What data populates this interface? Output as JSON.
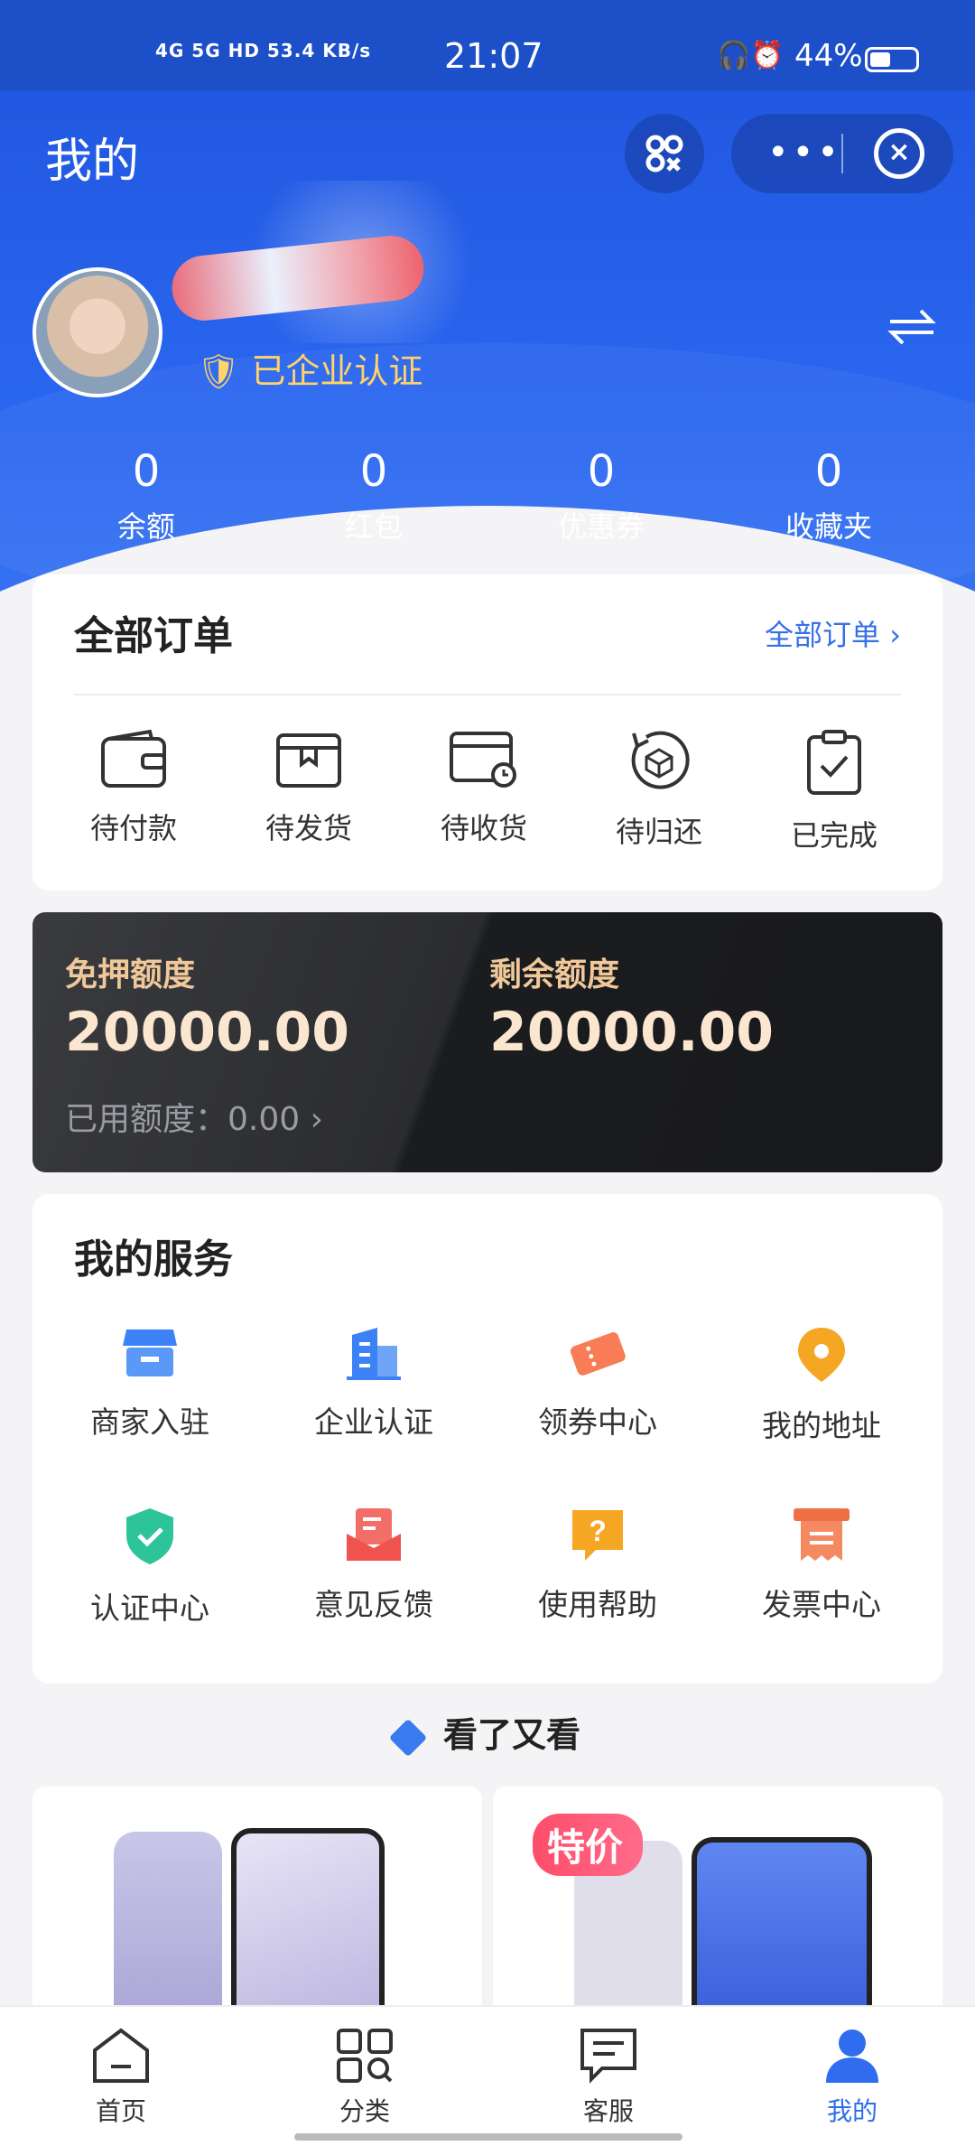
{
  "status_bar": {
    "network": "4G 5G HD 53.4 KB/s",
    "time": "21:07",
    "battery": "44%"
  },
  "header": {
    "title": "我的"
  },
  "profile": {
    "cert_label": "已企业认证"
  },
  "stats": [
    {
      "value": "0",
      "label": "余额"
    },
    {
      "value": "0",
      "label": "红包"
    },
    {
      "value": "0",
      "label": "优惠券"
    },
    {
      "value": "0",
      "label": "收藏夹"
    }
  ],
  "orders": {
    "title": "全部订单",
    "link": "全部订单",
    "items": [
      {
        "label": "待付款",
        "icon": "wallet-icon"
      },
      {
        "label": "待发货",
        "icon": "package-icon"
      },
      {
        "label": "待收货",
        "icon": "receive-icon"
      },
      {
        "label": "待归还",
        "icon": "return-icon"
      },
      {
        "label": "已完成",
        "icon": "clipboard-check-icon"
      }
    ]
  },
  "credit": {
    "deposit_free_label": "免押额度",
    "deposit_free_value": "20000.00",
    "remaining_label": "剩余额度",
    "remaining_value": "20000.00",
    "used_text": "已用额度：0.00"
  },
  "services": {
    "title": "我的服务",
    "items": [
      {
        "label": "商家入驻",
        "icon": "store-icon",
        "color": "#3c82f6"
      },
      {
        "label": "企业认证",
        "icon": "building-icon",
        "color": "#3c82f6"
      },
      {
        "label": "领券中心",
        "icon": "ticket-icon",
        "color": "#f87c56"
      },
      {
        "label": "我的地址",
        "icon": "location-pin-icon",
        "color": "#f5a623"
      },
      {
        "label": "认证中心",
        "icon": "shield-check-icon",
        "color": "#2dc49a"
      },
      {
        "label": "意见反馈",
        "icon": "feedback-icon",
        "color": "#f0524d"
      },
      {
        "label": "使用帮助",
        "icon": "help-icon",
        "color": "#f5a623"
      },
      {
        "label": "发票中心",
        "icon": "invoice-icon",
        "color": "#f06e46"
      }
    ]
  },
  "recommend": {
    "title": "看了又看",
    "badge": "特价"
  },
  "tabbar": [
    {
      "label": "首页",
      "icon": "home-icon"
    },
    {
      "label": "分类",
      "icon": "category-icon"
    },
    {
      "label": "客服",
      "icon": "chat-icon"
    },
    {
      "label": "我的",
      "icon": "user-icon"
    }
  ],
  "colors": {
    "accent": "#2f6cf0",
    "gold": "#f0c89a"
  }
}
